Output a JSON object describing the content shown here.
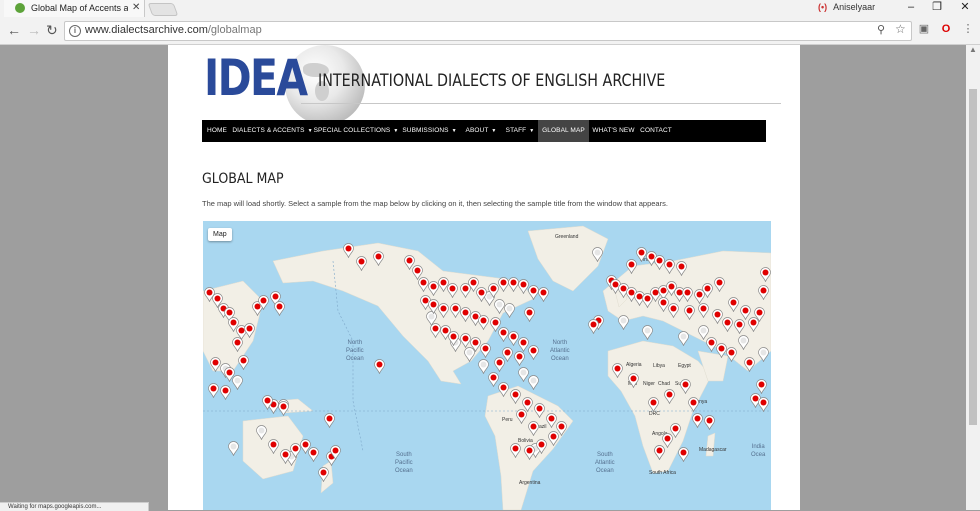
{
  "browser": {
    "tab_title": "Global Map of Accents a",
    "url_host": "www.dialectsarchive.com",
    "url_path": "/globalmap",
    "profile_name": "Aniselyaar",
    "status_text": "Waiting for maps.googleapis.com..."
  },
  "site": {
    "logo_text": "IDEA",
    "title": "INTERNATIONAL DIALECTS OF ENGLISH ARCHIVE",
    "nav": [
      {
        "label": "HOME",
        "dropdown": false,
        "active": false
      },
      {
        "label": "DIALECTS & ACCENTS",
        "dropdown": true,
        "active": false
      },
      {
        "label": "SPECIAL COLLECTIONS",
        "dropdown": true,
        "active": false
      },
      {
        "label": "SUBMISSIONS",
        "dropdown": true,
        "active": false
      },
      {
        "label": "ABOUT",
        "dropdown": true,
        "active": false
      },
      {
        "label": "STAFF",
        "dropdown": true,
        "active": false
      },
      {
        "label": "GLOBAL MAP",
        "dropdown": false,
        "active": true
      },
      {
        "label": "WHAT'S NEW",
        "dropdown": false,
        "active": false
      },
      {
        "label": "CONTACT",
        "dropdown": false,
        "active": false
      }
    ],
    "heading": "GLOBAL MAP",
    "intro": "The map will load shortly.  Select a sample from the map below by clicking on it, then selecting the sample title from the window that appears."
  },
  "map": {
    "type_button": "Map",
    "ocean_labels": [
      "North\nPacific\nOcean",
      "North\nAtlantic\nOcean",
      "South\nPacific\nOcean",
      "South\nAtlantic\nOcean",
      "India\nOcea"
    ],
    "place_labels": [
      "Greenland",
      "Finland",
      "Algeria",
      "Libya",
      "Egypt",
      "DRC",
      "Angola",
      "Madagascar",
      "South Africa",
      "Brazil",
      "Bolivia",
      "Argentina",
      "Peru",
      "Chad",
      "Mali",
      "Niger",
      "Sudan",
      "Kenya"
    ],
    "marker_colors": {
      "red": "#e00000",
      "gray": "#e6e6e6"
    }
  },
  "colors": {
    "logo_blue": "#2a4a9a",
    "water": "#a9d7f0",
    "land": "#f2efe6",
    "nav_bg": "#000000"
  }
}
